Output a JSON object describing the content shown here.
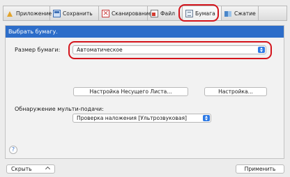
{
  "tabs": [
    {
      "label": "Приложение",
      "icon": "application-icon"
    },
    {
      "label": "Сохранить",
      "icon": "save-icon"
    },
    {
      "label": "Сканирование",
      "icon": "scan-icon"
    },
    {
      "label": "Файл",
      "icon": "file-icon"
    },
    {
      "label": "Бумага",
      "icon": "paper-icon",
      "selected": true
    },
    {
      "label": "Сжатие",
      "icon": "compression-icon"
    }
  ],
  "panel": {
    "header": "Выбрать бумагу.",
    "paper_size_label": "Размер бумаги:",
    "paper_size_value": "Автоматическое",
    "carrier_sheet_button": "Настройка Несущего Листа...",
    "settings_button": "Настройка...",
    "multifeed_label": "Обнаружение мульти-подачи:",
    "multifeed_value": "Проверка наложения [Ультрозвуковая]",
    "help": "?"
  },
  "footer": {
    "hide_button": "Скрыть",
    "apply_button": "Применить"
  },
  "colors": {
    "accent": "#2d6dc9",
    "highlight": "#d4141c",
    "stepper": "#2e7ae5"
  }
}
